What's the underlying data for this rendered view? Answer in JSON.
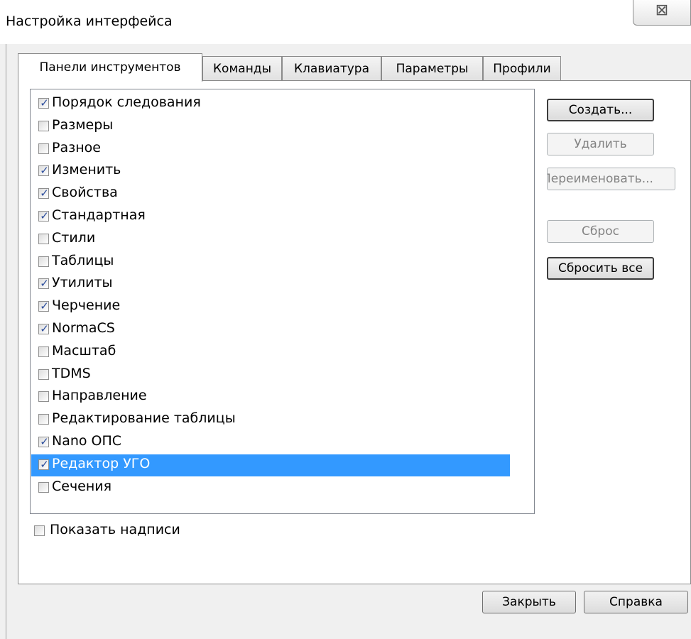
{
  "window": {
    "title": "Настройка интерфейса",
    "close_glyph": "⊠"
  },
  "tabs": [
    {
      "label": "Панели инструментов",
      "active": true
    },
    {
      "label": "Команды",
      "active": false
    },
    {
      "label": "Клавиатура",
      "active": false
    },
    {
      "label": "Параметры",
      "active": false
    },
    {
      "label": "Профили",
      "active": false
    }
  ],
  "toolbars": [
    {
      "label": "Порядок следования",
      "checked": true
    },
    {
      "label": "Размеры",
      "checked": false
    },
    {
      "label": "Разное",
      "checked": false
    },
    {
      "label": "Изменить",
      "checked": true
    },
    {
      "label": "Свойства",
      "checked": true
    },
    {
      "label": "Стандартная",
      "checked": true
    },
    {
      "label": "Стили",
      "checked": false
    },
    {
      "label": "Таблицы",
      "checked": false
    },
    {
      "label": "Утилиты",
      "checked": true
    },
    {
      "label": "Черчение",
      "checked": true
    },
    {
      "label": "NormaCS",
      "checked": true
    },
    {
      "label": "Масштаб",
      "checked": false
    },
    {
      "label": "TDMS",
      "checked": false
    },
    {
      "label": "Направление",
      "checked": false
    },
    {
      "label": "Редактирование таблицы",
      "checked": false
    },
    {
      "label": "Nano ОПС",
      "checked": true
    },
    {
      "label": "Редактор УГО",
      "checked": true,
      "selected": true
    },
    {
      "label": "Сечения",
      "checked": false
    }
  ],
  "buttons": {
    "create": "Создать...",
    "delete": "Удалить",
    "rename": "Переименовать...",
    "reset": "Сброс",
    "reset_all": "Сбросить все",
    "close": "Закрыть",
    "help": "Справка"
  },
  "show_labels": {
    "label": "Показать надписи",
    "checked": false
  },
  "scrollbar": {
    "up_icon": "▲",
    "down_icon": "▼"
  },
  "colors": {
    "selection": "#3399ff"
  }
}
